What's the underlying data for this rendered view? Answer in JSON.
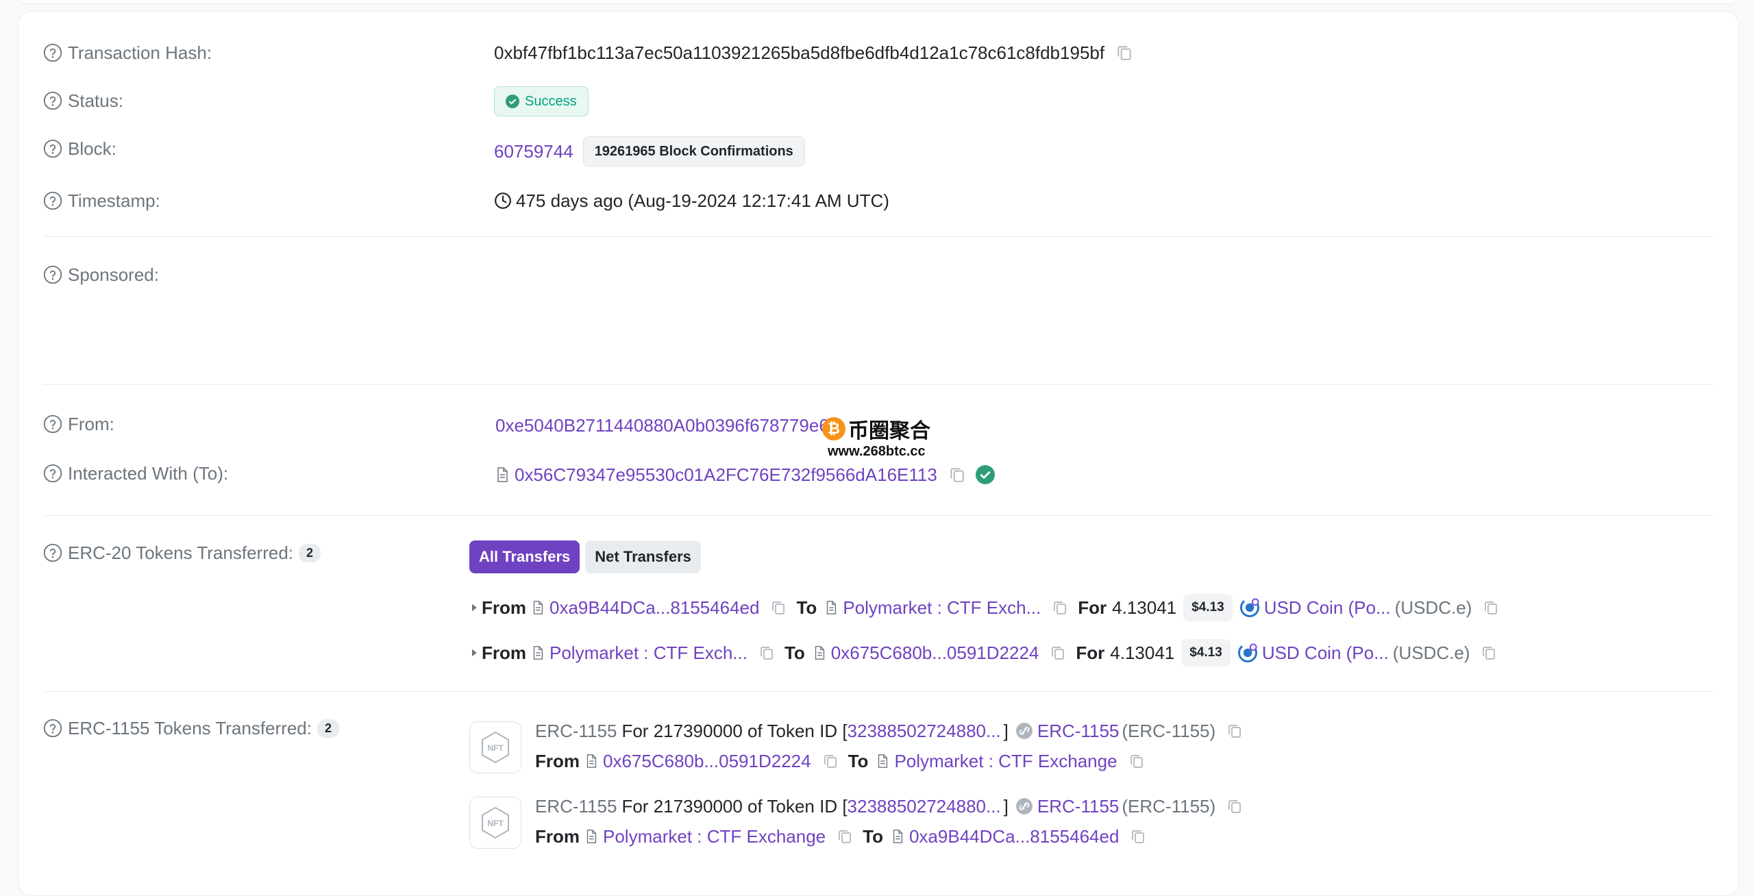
{
  "fields": {
    "tx_hash": {
      "label": "Transaction Hash:",
      "value": "0xbf47fbf1bc113a7ec50a1103921265ba5d8fbe6dfb4d12a1c78c61c8fdb195bf"
    },
    "status": {
      "label": "Status:",
      "value": "Success"
    },
    "block": {
      "label": "Block:",
      "number": "60759744",
      "confirmations": "19261965 Block Confirmations"
    },
    "timestamp": {
      "label": "Timestamp:",
      "value": "475 days ago (Aug-19-2024 12:17:41 AM UTC)"
    },
    "sponsored": {
      "label": "Sponsored:"
    },
    "from": {
      "label": "From:",
      "value": "0xe5040B2711440880A0b0396f678779e65"
    },
    "to": {
      "label": "Interacted With (To):",
      "value": "0x56C79347e95530c01A2FC76E732f9566dA16E113"
    }
  },
  "watermark": {
    "title": "币圈聚合",
    "coin": "₿",
    "url": "www.268btc.cc"
  },
  "erc20": {
    "label": "ERC-20 Tokens Transferred:",
    "count": "2",
    "tabs": [
      "All Transfers",
      "Net Transfers"
    ],
    "words": {
      "from": "From",
      "to": "To",
      "for": "For"
    },
    "transfers": [
      {
        "from": "0xa9B44DCa...8155464ed",
        "to": "Polymarket : CTF Exch...",
        "amount": "4.13041",
        "usd": "$4.13",
        "token": "USD Coin (Po...",
        "symbol": "(USDC.e)"
      },
      {
        "from": "Polymarket : CTF Exch...",
        "to": "0x675C680b...0591D2224",
        "amount": "4.13041",
        "usd": "$4.13",
        "token": "USD Coin (Po...",
        "symbol": "(USDC.e)"
      }
    ]
  },
  "erc1155": {
    "label": "ERC-1155 Tokens Transferred:",
    "count": "2",
    "transfers": [
      {
        "type": "ERC-1155",
        "for_text": "For 217390000 of Token ID [",
        "token_id": "32388502724880...",
        "close": "]",
        "token": "ERC-1155",
        "symbol": "(ERC-1155)",
        "from_label": "From",
        "from": "0x675C680b...0591D2224",
        "to_label": "To",
        "to": "Polymarket : CTF Exchange"
      },
      {
        "type": "ERC-1155",
        "for_text": "For 217390000 of Token ID [",
        "token_id": "32388502724880...",
        "close": "]",
        "token": "ERC-1155",
        "symbol": "(ERC-1155)",
        "from_label": "From",
        "from": "Polymarket : CTF Exchange",
        "to_label": "To",
        "to": "0xa9B44DCa...8155464ed"
      }
    ]
  },
  "icons": {
    "nft": "NFT"
  },
  "colors": {
    "accent": "#6f42c1",
    "success": "#00a186",
    "muted": "#6c757d"
  }
}
